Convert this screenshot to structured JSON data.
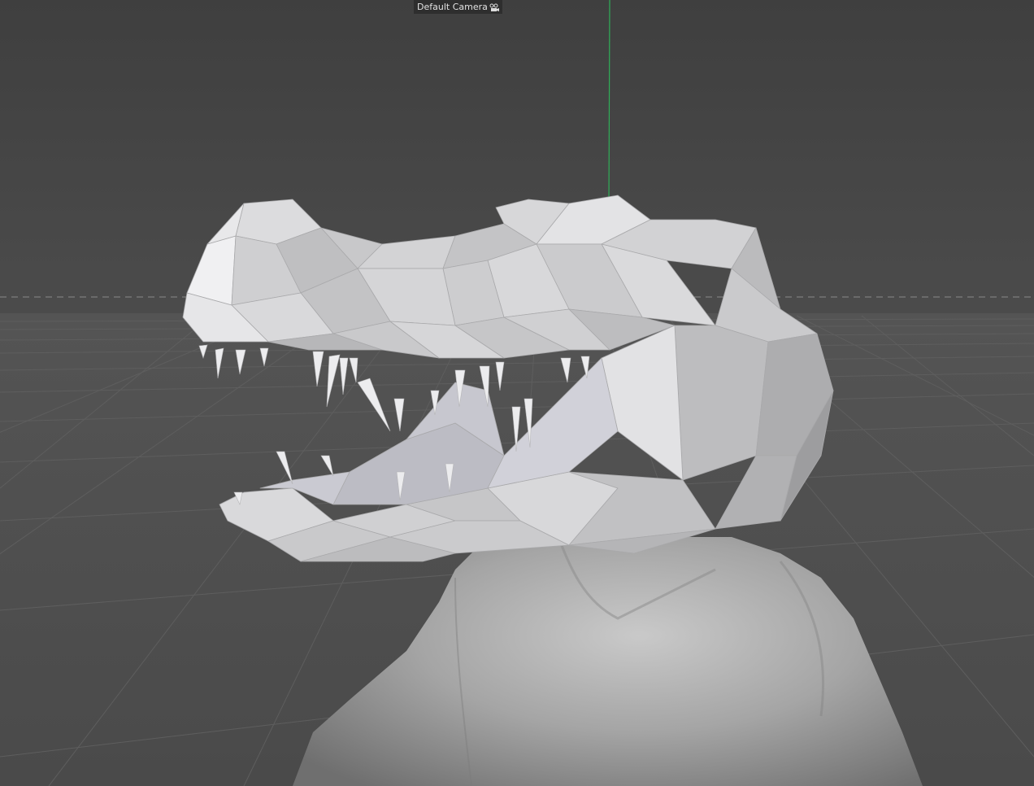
{
  "viewport": {
    "camera_label": "Default Camera",
    "camera_icon": "camera-icon"
  },
  "colors": {
    "background": "#4a4a4a",
    "grid_line": "#5c5c5c",
    "horizon_line": "#8a8a8a",
    "y_axis": "#2fae57",
    "model_light": "#d9d9db",
    "model_mid": "#b9b9bb",
    "model_dark": "#8c8c8e"
  }
}
